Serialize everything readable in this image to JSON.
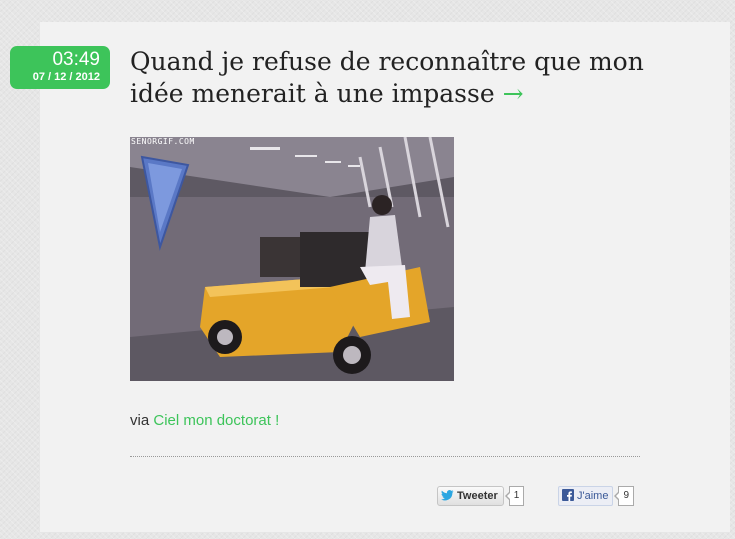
{
  "post": {
    "time": "03:49",
    "date": "07 / 12 / 2012",
    "title": "Quand je refuse de reconnaître que mon idée menerait à une impasse",
    "title_arrow": "→",
    "gif_watermark": "SENORGIF.COM",
    "via_label": "via",
    "via_link": "Ciel mon doctorat !"
  },
  "share": {
    "tweet_label": "Tweeter",
    "tweet_count": "1",
    "like_label": "J'aime",
    "like_count": "9"
  },
  "colors": {
    "accent": "#3dc45a",
    "facebook": "#3b5998",
    "twitter": "#2ba6e1"
  },
  "icons": [
    "twitter-bird-icon",
    "facebook-f-icon"
  ]
}
